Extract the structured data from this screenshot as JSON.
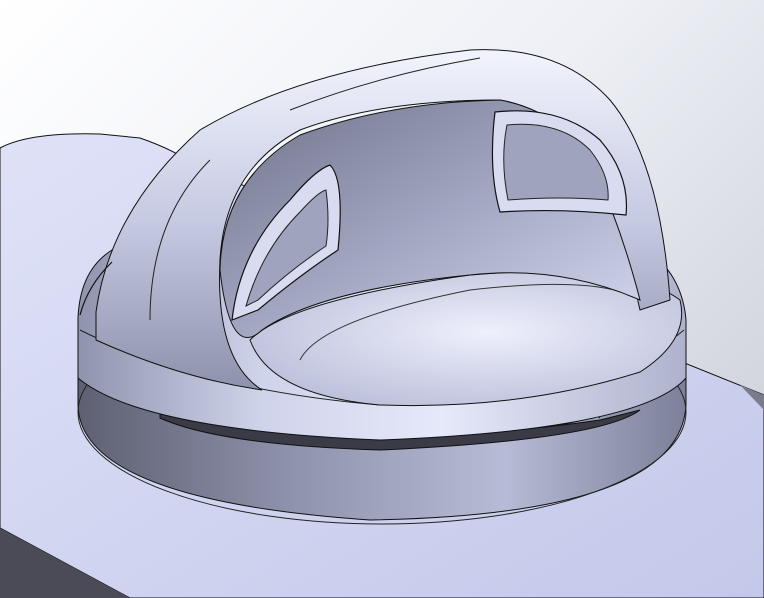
{
  "scene": {
    "subject": "cap",
    "colors": {
      "background_light": "#ffffff",
      "background_dark": "#c5c7d2",
      "base_plate": "#cfd3ef",
      "base_plate_side": "#4a4b57",
      "body_light": "#e3e6f8",
      "body_mid": "#a7abc6",
      "body_dark": "#5b5d70",
      "edge_line": "#111111"
    }
  }
}
